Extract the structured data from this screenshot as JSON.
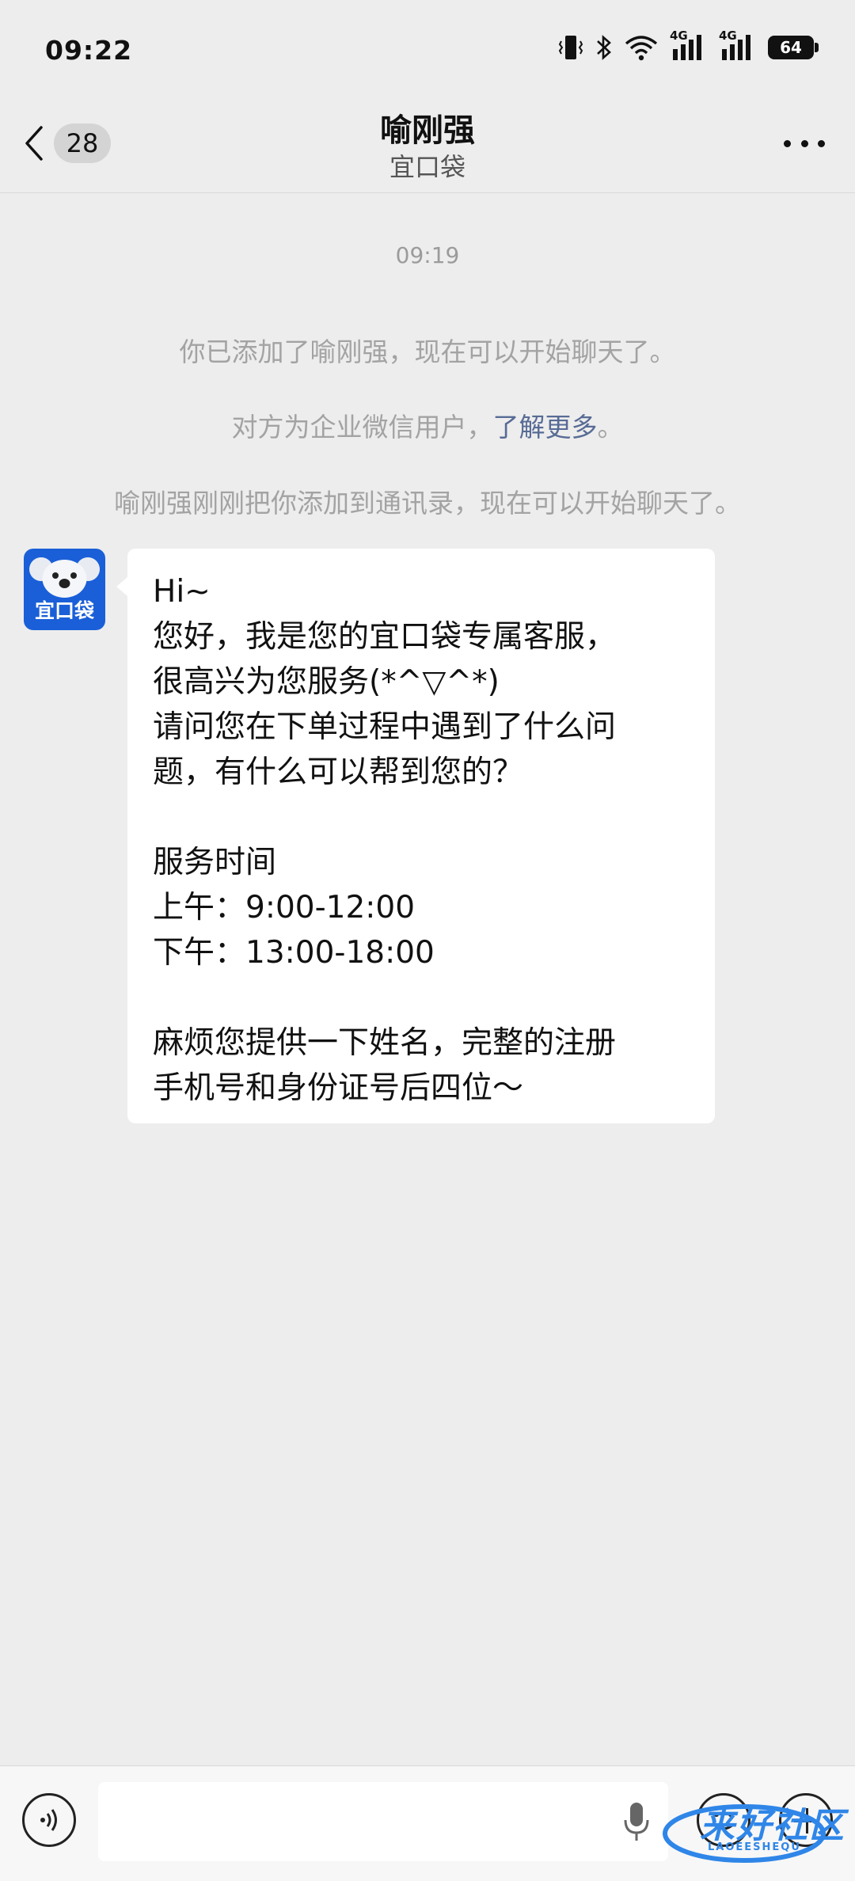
{
  "status_bar": {
    "time": "09:22",
    "network_1": "4G",
    "network_2": "4G",
    "battery": "64"
  },
  "header": {
    "back_badge": "28",
    "title": "喻刚强",
    "subtitle": "宜口袋"
  },
  "chat": {
    "timestamp": "09:19",
    "system_messages": [
      "你已添加了喻刚强，现在可以开始聊天了。",
      "对方为企业微信用户，",
      "喻刚强刚刚把你添加到通讯录，现在可以开始聊天了。"
    ],
    "learn_more_link": "了解更多",
    "learn_more_suffix": "。",
    "avatar_label": "宜口袋",
    "message_lines": [
      "Hi~",
      "您好，我是您的宜口袋专属客服，",
      "很高兴为您服务(*^▽^*)",
      "请问您在下单过程中遇到了什么问",
      "题，有什么可以帮到您的？",
      "",
      "服务时间",
      "上午：9:00-12:00",
      "下午：13:00-18:00",
      "",
      "麻烦您提供一下姓名，完整的注册",
      "手机号和身份证号后四位～"
    ]
  },
  "input_bar": {
    "placeholder": ""
  },
  "watermark": {
    "text": "来好社区",
    "subtext": "LAOEESHEQU"
  }
}
